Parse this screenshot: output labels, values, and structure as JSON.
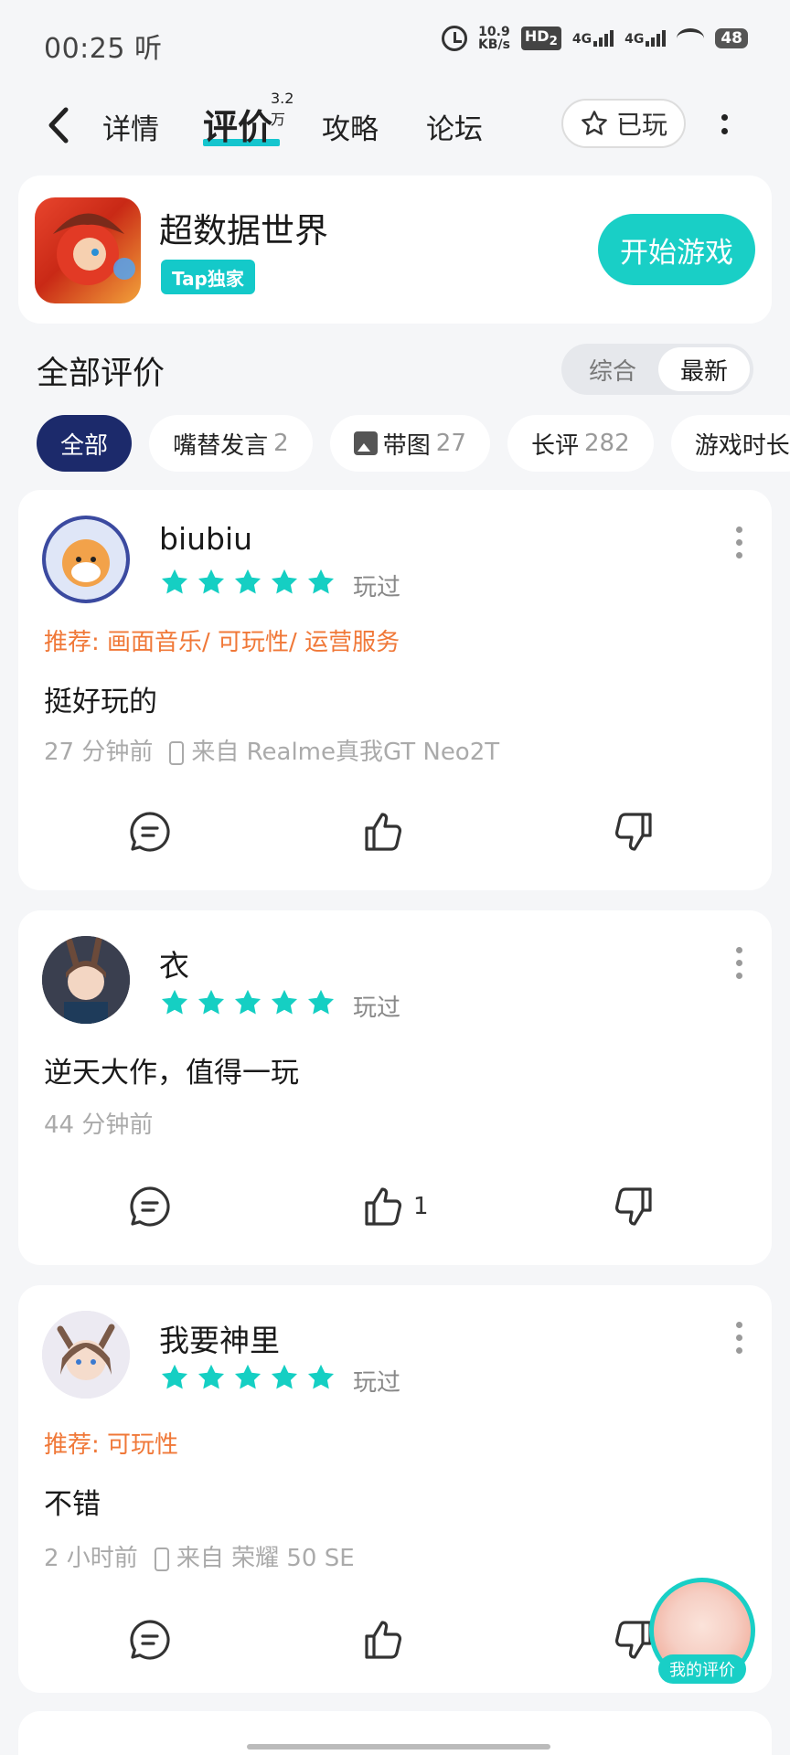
{
  "status_bar": {
    "time": "00:25 听",
    "speed": "10.9",
    "speed_unit": "KB/s",
    "hd": "HD",
    "hd_sub": "2",
    "net1": "4G",
    "net2": "4G",
    "battery": "48"
  },
  "nav": {
    "tabs": [
      "详情",
      "评价",
      "攻略",
      "论坛"
    ],
    "active_tab": "评价",
    "review_count_badge": "3.2万",
    "played_label": "已玩"
  },
  "game": {
    "name": "超数据世界",
    "badge": "Tap独家",
    "start_button": "开始游戏"
  },
  "section": {
    "title": "全部评价",
    "sort_options": [
      "综合",
      "最新"
    ],
    "sort_selected": "最新"
  },
  "filters": [
    {
      "label": "全部",
      "count": ""
    },
    {
      "label": "嘴替发言",
      "count": "2"
    },
    {
      "label": "带图",
      "count": "27"
    },
    {
      "label": "长评",
      "count": "282"
    },
    {
      "label": "游戏时长",
      "count": ""
    }
  ],
  "reviews": [
    {
      "user": "biubiu",
      "rating": 5,
      "status": "玩过",
      "recommend": "推荐: 画面音乐/ 可玩性/ 运营服务",
      "text": "挺好玩的",
      "time": "27 分钟前",
      "device": "来自 Realme真我GT Neo2T",
      "likes": ""
    },
    {
      "user": "衣",
      "rating": 5,
      "status": "玩过",
      "recommend": "",
      "text": "逆天大作，值得一玩",
      "time": "44 分钟前",
      "device": "",
      "likes": "1"
    },
    {
      "user": "我要神里",
      "rating": 5,
      "status": "玩过",
      "recommend": "推荐: 可玩性",
      "text": "不错",
      "time": "2 小时前",
      "device": "来自 荣耀 50 SE",
      "likes": ""
    }
  ],
  "fab": {
    "label": "我的评价"
  },
  "colors": {
    "accent": "#19cfc6",
    "star": "#15cfc3",
    "recommend": "#f07838",
    "active_chip": "#1c2a6b"
  },
  "icons": [
    "back-arrow-icon",
    "star-outline-icon",
    "more-vertical-icon",
    "comment-icon",
    "thumbs-up-icon",
    "thumbs-down-icon",
    "phone-icon",
    "image-icon"
  ]
}
